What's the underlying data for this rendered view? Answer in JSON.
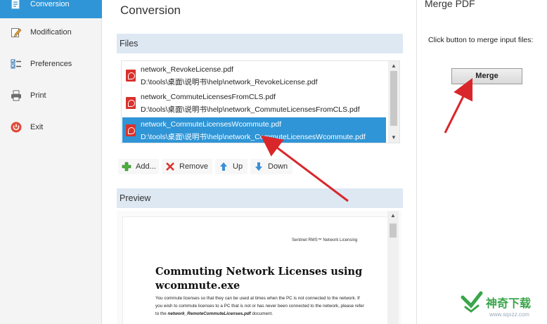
{
  "sidebar": {
    "items": [
      {
        "label": "Conversion",
        "icon": "conversion-icon",
        "active": true
      },
      {
        "label": "Modification",
        "icon": "edit-icon"
      },
      {
        "label": "Preferences",
        "icon": "preferences-icon"
      },
      {
        "label": "Print",
        "icon": "printer-icon"
      },
      {
        "label": "Exit",
        "icon": "power-icon"
      }
    ]
  },
  "main": {
    "title": "Conversion",
    "files_label": "Files",
    "files": [
      {
        "name": "network_RevokeLicense.pdf",
        "path": "D:\\tools\\桌面\\说明书\\help\\network_RevokeLicense.pdf",
        "selected": false
      },
      {
        "name": "network_CommuteLicensesFromCLS.pdf",
        "path": "D:\\tools\\桌面\\说明书\\help\\network_CommuteLicensesFromCLS.pdf",
        "selected": false
      },
      {
        "name": "network_CommuteLicensesWcommute.pdf",
        "path": "D:\\tools\\桌面\\说明书\\help\\network_CommuteLicensesWcommute.pdf",
        "selected": true
      }
    ],
    "toolbar": {
      "add": "Add...",
      "remove": "Remove",
      "up": "Up",
      "down": "Down"
    },
    "preview_label": "Preview",
    "preview": {
      "header": "Sentinel RMS™ Network Licensing",
      "title": "Commuting Network Licenses using wcommute.exe",
      "body_1": "You commute licenses so that they can be used at times when the PC is not connected to the network.  If you wish to commute licenses to a PC that is not or has never been connected to the network, please refer to the",
      "body_link": "network_RemoteCommuteLicenses.pdf",
      "body_2": "document."
    }
  },
  "right": {
    "title": "Merge PDF",
    "hint": "Click button to merge input files:",
    "merge_label": "Merge"
  },
  "watermark": {
    "text": "神奇下载",
    "url": "www.sqxzz.com"
  },
  "colors": {
    "accent": "#2f95d6",
    "section_bar": "#dde8f3",
    "annotation_arrow": "#d9262a"
  }
}
